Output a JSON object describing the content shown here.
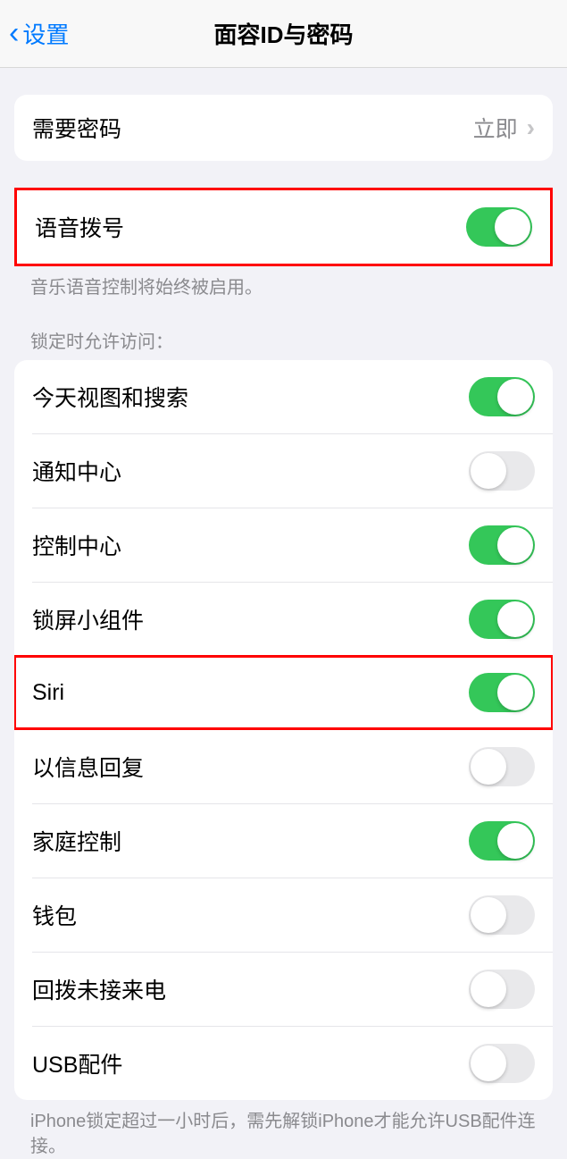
{
  "nav": {
    "back_label": "设置",
    "title": "面容ID与密码"
  },
  "require_passcode": {
    "label": "需要密码",
    "value": "立即"
  },
  "voice_dial": {
    "label": "语音拨号",
    "on": true,
    "footer": "音乐语音控制将始终被启用。"
  },
  "lock_access": {
    "header": "锁定时允许访问：",
    "items": [
      {
        "label": "今天视图和搜索",
        "on": true,
        "highlight": false
      },
      {
        "label": "通知中心",
        "on": false,
        "highlight": false
      },
      {
        "label": "控制中心",
        "on": true,
        "highlight": false
      },
      {
        "label": "锁屏小组件",
        "on": true,
        "highlight": false
      },
      {
        "label": "Siri",
        "on": true,
        "highlight": true
      },
      {
        "label": "以信息回复",
        "on": false,
        "highlight": false
      },
      {
        "label": "家庭控制",
        "on": true,
        "highlight": false
      },
      {
        "label": "钱包",
        "on": false,
        "highlight": false
      },
      {
        "label": "回拨未接来电",
        "on": false,
        "highlight": false
      },
      {
        "label": "USB配件",
        "on": false,
        "highlight": false
      }
    ],
    "footer": "iPhone锁定超过一小时后，需先解锁iPhone才能允许USB配件连接。"
  }
}
